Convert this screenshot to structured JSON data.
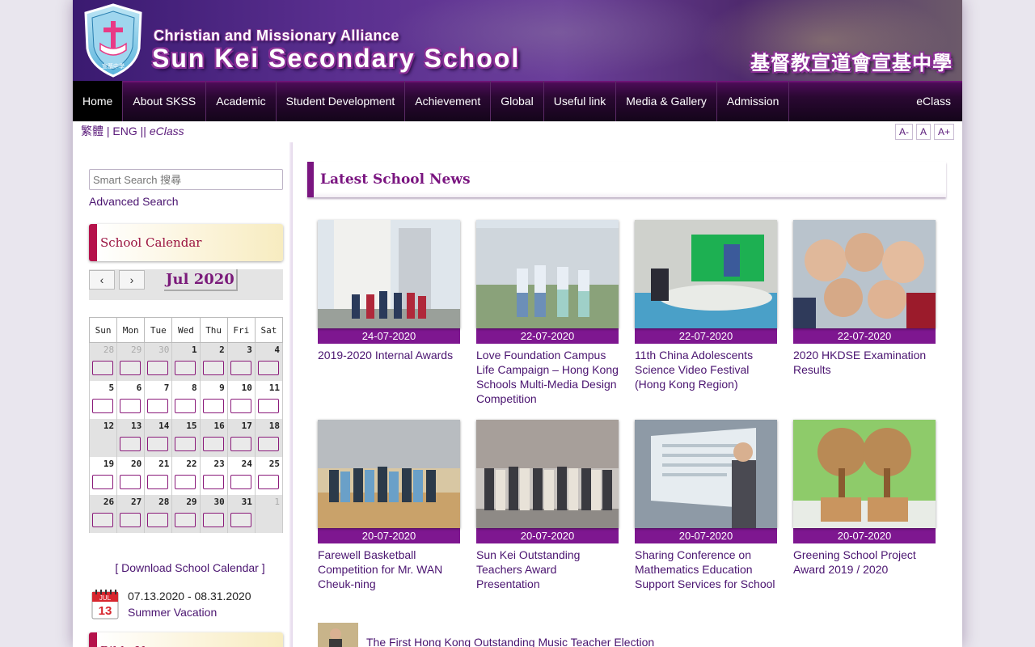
{
  "header": {
    "title_en_small": "Christian and Missionary Alliance",
    "title_en_big": "Sun Kei Secondary School",
    "title_zh": "基督教宣道會宣基中學",
    "crest_text": "宣基中學"
  },
  "nav": {
    "items": [
      {
        "label": "Home",
        "active": true
      },
      {
        "label": "About SKSS"
      },
      {
        "label": "Academic"
      },
      {
        "label": "Student Development"
      },
      {
        "label": "Achievement"
      },
      {
        "label": "Global"
      },
      {
        "label": "Useful link"
      },
      {
        "label": "Media & Gallery"
      },
      {
        "label": "Admission"
      }
    ],
    "right": "eClass"
  },
  "lang": {
    "trad": "繁體",
    "sep1": " | ",
    "eng": "ENG",
    "sep2": " || ",
    "eclass": "eClass"
  },
  "font_size": {
    "smaller": "A-",
    "normal": "A",
    "larger": "A+"
  },
  "sidebar": {
    "search_placeholder": "Smart Search 搜尋",
    "advanced_search": "Advanced Search",
    "calendar_heading": "School Calendar",
    "month_label": "Jul 2020",
    "prev": "‹",
    "next": "›",
    "weekdays": [
      "Sun",
      "Mon",
      "Tue",
      "Wed",
      "Thu",
      "Fri",
      "Sat"
    ],
    "weeks": [
      [
        "28",
        "29",
        "30",
        "1",
        "2",
        "3",
        "4"
      ],
      [
        "5",
        "6",
        "7",
        "8",
        "9",
        "10",
        "11"
      ],
      [
        "12",
        "13",
        "14",
        "15",
        "16",
        "17",
        "18"
      ],
      [
        "19",
        "20",
        "21",
        "22",
        "23",
        "24",
        "25"
      ],
      [
        "26",
        "27",
        "28",
        "29",
        "30",
        "31",
        "1"
      ]
    ],
    "download_prefix": "[ ",
    "download_label": "Download School Calendar",
    "download_suffix": " ]",
    "event_icon_month": "JUL",
    "event_icon_day": "13",
    "event_date": "07.13.2020 - 08.31.2020",
    "event_name": "Summer Vacation",
    "next_heading": "Bible Verse"
  },
  "main": {
    "news_heading": "Latest School News",
    "news": [
      {
        "date": "24-07-2020",
        "title": "2019-2020 Internal Awards"
      },
      {
        "date": "22-07-2020",
        "title": "Love Foundation Campus Life Campaign – Hong Kong Schools Multi-Media Design Competition"
      },
      {
        "date": "22-07-2020",
        "title": "11th China Adolescents Science Video Festival (Hong Kong Region)"
      },
      {
        "date": "22-07-2020",
        "title": "2020 HKDSE Examination Results"
      },
      {
        "date": "20-07-2020",
        "title": "Farewell Basketball Competition for Mr. WAN Cheuk-ning"
      },
      {
        "date": "20-07-2020",
        "title": "Sun Kei Outstanding Teachers Award Presentation"
      },
      {
        "date": "20-07-2020",
        "title": "Sharing Conference on Mathematics Education Support Services for School"
      },
      {
        "date": "20-07-2020",
        "title": "Greening School Project Award 2019 / 2020"
      }
    ],
    "music_title": "The First Hong Kong Outstanding Music Teacher Election"
  },
  "colors": {
    "brand_purple": "#7e1790",
    "accent_red": "#b5124b",
    "link": "#4a1470"
  }
}
